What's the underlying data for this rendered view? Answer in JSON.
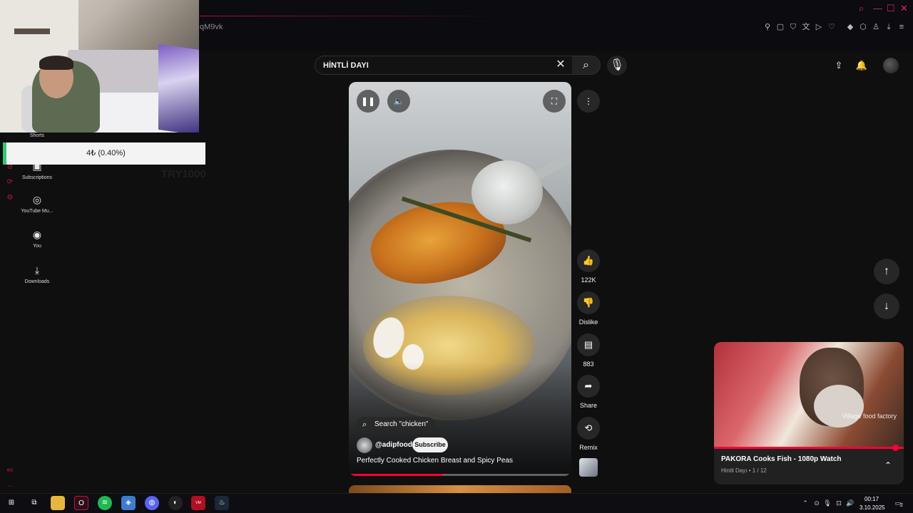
{
  "browser": {
    "url_fragment": "qM9vk",
    "window_controls": [
      "search-icon",
      "minimize-icon",
      "maximize-icon",
      "close-icon"
    ],
    "toolbar_icons": [
      "pin-icon",
      "bookmark-icon",
      "shield-icon",
      "translate-icon",
      "play-icon",
      "heart-icon",
      "extension-icon",
      "puzzle-icon",
      "profile-icon",
      "download-icon",
      "menu-icon"
    ]
  },
  "overlay": {
    "donation_text": "4₺ (0.40%)",
    "goal_text": "TRY1000"
  },
  "left_rail": {
    "items": [
      {
        "label": "Shorts",
        "icon": "shorts-icon"
      },
      {
        "label": "Subscriptions",
        "icon": "subscriptions-icon"
      },
      {
        "label": "YouTube Mu...",
        "icon": "youtube-music-icon"
      },
      {
        "label": "You",
        "icon": "user-icon"
      },
      {
        "label": "Downloads",
        "icon": "download-icon"
      }
    ],
    "bottom_labels": [
      "ex",
      "..."
    ]
  },
  "search": {
    "query": "HİNTLİ DAYI"
  },
  "video": {
    "search_chip": "Search \"chicken\"",
    "channel": "@adipfood",
    "subscribe_label": "Subscribe",
    "title": "Perfectly Cooked Chicken Breast and Spicy Peas",
    "progress_fraction": 0.42
  },
  "actions": {
    "like_count": "122K",
    "dislike_label": "Dislike",
    "comment_count": "883",
    "share_label": "Share",
    "remix_label": "Remix"
  },
  "mini_player": {
    "title": "PAKORA Cooks Fish - 1080p Watch",
    "subtitle": "Hintli Dayı • 1 / 12",
    "watermark": "Village food factory",
    "progress_fraction": 0.95
  },
  "taskbar": {
    "time": "00:17",
    "date": "3.10.2025",
    "notification_count": "2"
  }
}
